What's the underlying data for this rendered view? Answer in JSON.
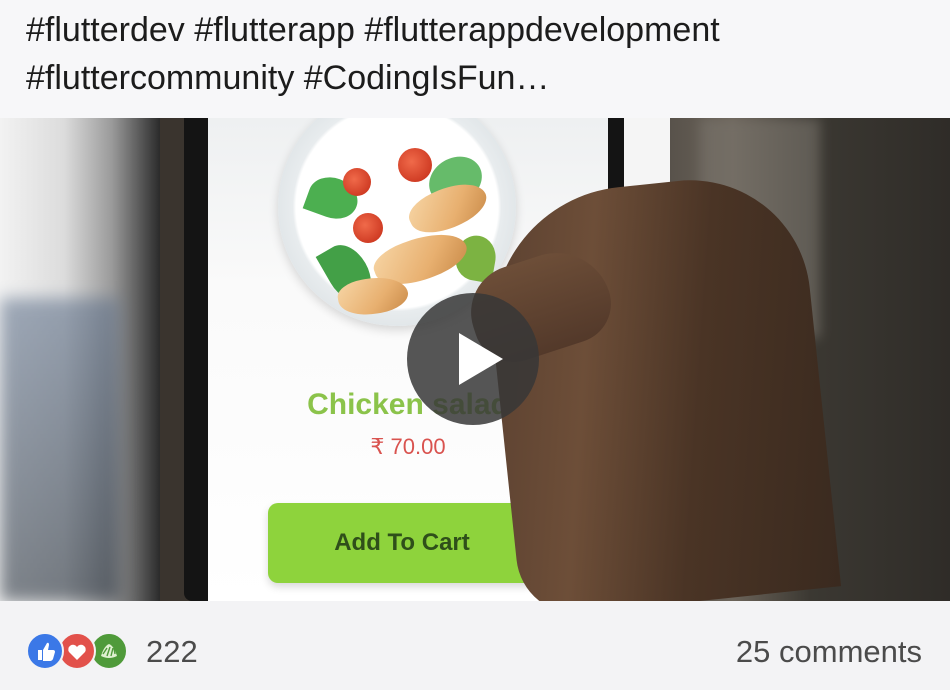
{
  "post": {
    "caption": "#flutterdev #flutterapp #flutterappdevelopment #fluttercommunity #CodingIsFun…"
  },
  "video": {
    "play_icon": "play-icon",
    "app_screen": {
      "product_name": "Chicken salad",
      "price": "₹ 70.00",
      "add_to_cart_label": "Add To Cart"
    }
  },
  "reactions": {
    "icons": [
      "like-icon",
      "love-icon",
      "care-icon"
    ],
    "count": "222",
    "comments_label": "25 comments"
  },
  "colors": {
    "accent_green": "#8ed33c",
    "price_red": "#d9534f",
    "like_blue": "#3b78e7",
    "love_red": "#e2514b"
  }
}
